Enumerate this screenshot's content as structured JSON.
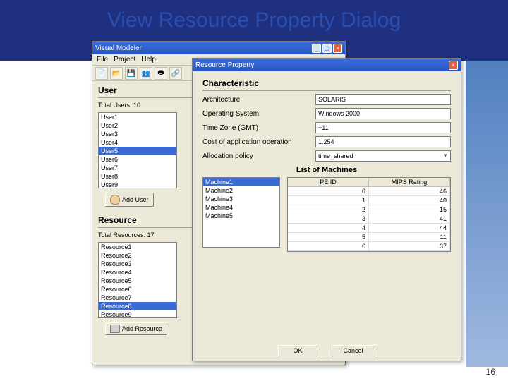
{
  "slide": {
    "title": "View Resource Property Dialog",
    "page": "16"
  },
  "vmwin": {
    "title": "Visual Modeler",
    "menu": [
      "File",
      "Project",
      "Help"
    ],
    "user": {
      "heading": "User",
      "total_label": "Total Users:",
      "total_val": "10",
      "items": [
        "User1",
        "User2",
        "User3",
        "User4",
        "User5",
        "User6",
        "User7",
        "User8",
        "User9"
      ],
      "sel_index": 4,
      "add_btn": "Add User"
    },
    "resource": {
      "heading": "Resource",
      "total_label": "Total Resources:",
      "total_val": "17",
      "items": [
        "Resource1",
        "Resource2",
        "Resource3",
        "Resource4",
        "Resource5",
        "Resource6",
        "Resource7",
        "Resource8",
        "Resource9"
      ],
      "sel_index": 7,
      "add_btn": "Add Resource"
    }
  },
  "rpwin": {
    "title": "Resource Property",
    "char_heading": "Characteristic",
    "fields": {
      "arch_label": "Architecture",
      "arch_val": "SOLARIS",
      "os_label": "Operating System",
      "os_val": "Windows 2000",
      "tz_label": "Time Zone (GMT)",
      "tz_val": "+11",
      "cost_label": "Cost of application operation",
      "cost_val": "1.254",
      "alloc_label": "Allocation policy",
      "alloc_val": "time_shared"
    },
    "list_heading": "List of Machines",
    "machines": {
      "items": [
        "Machine1",
        "Machine2",
        "Machine3",
        "Machine4",
        "Machine5"
      ],
      "sel_index": 0
    },
    "tbl": {
      "h1": "PE ID",
      "h2": "MIPS Rating",
      "rows": [
        [
          "0",
          "46"
        ],
        [
          "1",
          "40"
        ],
        [
          "2",
          "15"
        ],
        [
          "3",
          "41"
        ],
        [
          "4",
          "44"
        ],
        [
          "5",
          "11"
        ],
        [
          "6",
          "37"
        ]
      ]
    },
    "ok": "OK",
    "cancel": "Cancel"
  }
}
